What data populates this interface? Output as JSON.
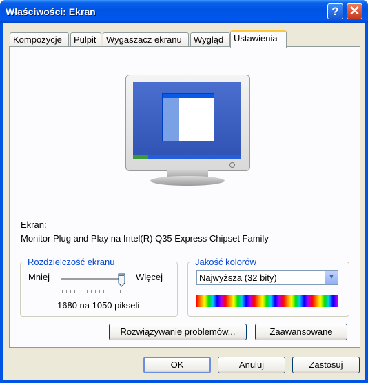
{
  "window": {
    "title": "Właściwości: Ekran"
  },
  "titlebar": {
    "help_label": "?",
    "close_label": "✕"
  },
  "tabs": [
    {
      "label": "Kompozycje"
    },
    {
      "label": "Pulpit"
    },
    {
      "label": "Wygaszacz ekranu"
    },
    {
      "label": "Wygląd"
    },
    {
      "label": "Ustawienia"
    }
  ],
  "display": {
    "label": "Ekran:",
    "device": "Monitor Plug and Play na Intel(R) Q35 Express Chipset Family"
  },
  "resolution": {
    "title": "Rozdzielczość ekranu",
    "less_label": "Mniej",
    "more_label": "Więcej",
    "value_text": "1680 na 1050 pikseli",
    "slider_level": 1.0
  },
  "color_quality": {
    "title": "Jakość kolorów",
    "selected": "Najwyższa (32 bity)"
  },
  "actions": {
    "troubleshoot_label": "Rozwiązywanie problemów...",
    "advanced_label": "Zaawansowane"
  },
  "footer": {
    "ok_label": "OK",
    "cancel_label": "Anuluj",
    "apply_label": "Zastosuj"
  },
  "colors": {
    "accent": "#0054e3",
    "group_title": "#0046d5",
    "active_tab_highlight": "#ffc83c"
  }
}
